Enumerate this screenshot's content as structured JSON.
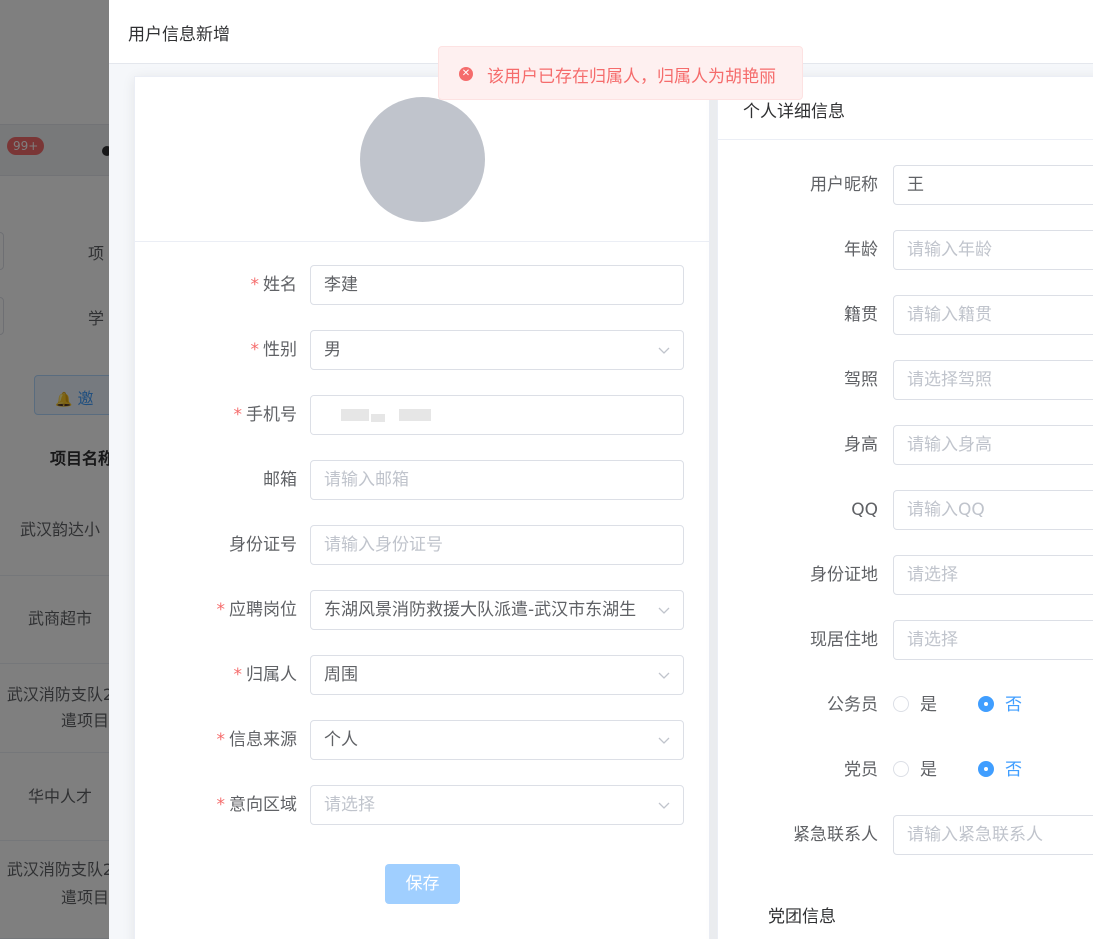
{
  "background": {
    "badge": "99+",
    "filter_labels": [
      "项",
      "学"
    ],
    "invite_label": "邀",
    "table_header": "项目名称",
    "rows": [
      "武汉韵达小",
      "武商超市",
      "武汉消防支队2",
      "遣项目",
      "华中人才",
      "武汉消防支队2",
      "遣项目"
    ]
  },
  "dialog": {
    "title": "用户信息新增"
  },
  "message": {
    "type": "error",
    "text": "该用户已存在归属人，归属人为胡艳丽"
  },
  "left_form": {
    "fields": [
      {
        "label": "姓名",
        "required": true,
        "value": "李建",
        "placeholder": "",
        "type": "input"
      },
      {
        "label": "性别",
        "required": true,
        "value": "男",
        "placeholder": "",
        "type": "select"
      },
      {
        "label": "手机号",
        "required": true,
        "value": "",
        "placeholder": "",
        "type": "input-masked"
      },
      {
        "label": "邮箱",
        "required": false,
        "value": "",
        "placeholder": "请输入邮箱",
        "type": "input"
      },
      {
        "label": "身份证号",
        "required": false,
        "value": "",
        "placeholder": "请输入身份证号",
        "type": "input"
      },
      {
        "label": "应聘岗位",
        "required": true,
        "value": "东湖风景消防救援大队派遣-武汉市东湖生",
        "placeholder": "",
        "type": "select"
      },
      {
        "label": "归属人",
        "required": true,
        "value": "周围",
        "placeholder": "",
        "type": "select"
      },
      {
        "label": "信息来源",
        "required": true,
        "value": "个人",
        "placeholder": "",
        "type": "select"
      },
      {
        "label": "意向区域",
        "required": true,
        "value": "",
        "placeholder": "请选择",
        "type": "select"
      }
    ],
    "save_label": "保存"
  },
  "right_form": {
    "header": "个人详细信息",
    "fields": [
      {
        "label": "用户昵称",
        "value": "王",
        "placeholder": ""
      },
      {
        "label": "年龄",
        "value": "",
        "placeholder": "请输入年龄"
      },
      {
        "label": "籍贯",
        "value": "",
        "placeholder": "请输入籍贯"
      },
      {
        "label": "驾照",
        "value": "",
        "placeholder": "请选择驾照"
      },
      {
        "label": "身高",
        "value": "",
        "placeholder": "请输入身高"
      },
      {
        "label": "QQ",
        "value": "",
        "placeholder": "请输入QQ"
      },
      {
        "label": "身份证地",
        "value": "",
        "placeholder": "请选择"
      },
      {
        "label": "现居住地",
        "value": "",
        "placeholder": "请选择"
      }
    ],
    "civil_servant": {
      "label": "公务员",
      "yes": "是",
      "no": "否",
      "selected": "否"
    },
    "party_member": {
      "label": "党员",
      "yes": "是",
      "no": "否",
      "selected": "否"
    },
    "emergency_contact": {
      "label": "紧急联系人",
      "placeholder": "请输入紧急联系人"
    },
    "section_party": "党团信息"
  },
  "colors": {
    "primary": "#409eff",
    "danger": "#f56c6c",
    "avatar": "#c0c4cc",
    "save_disabled": "#a0cfff"
  }
}
